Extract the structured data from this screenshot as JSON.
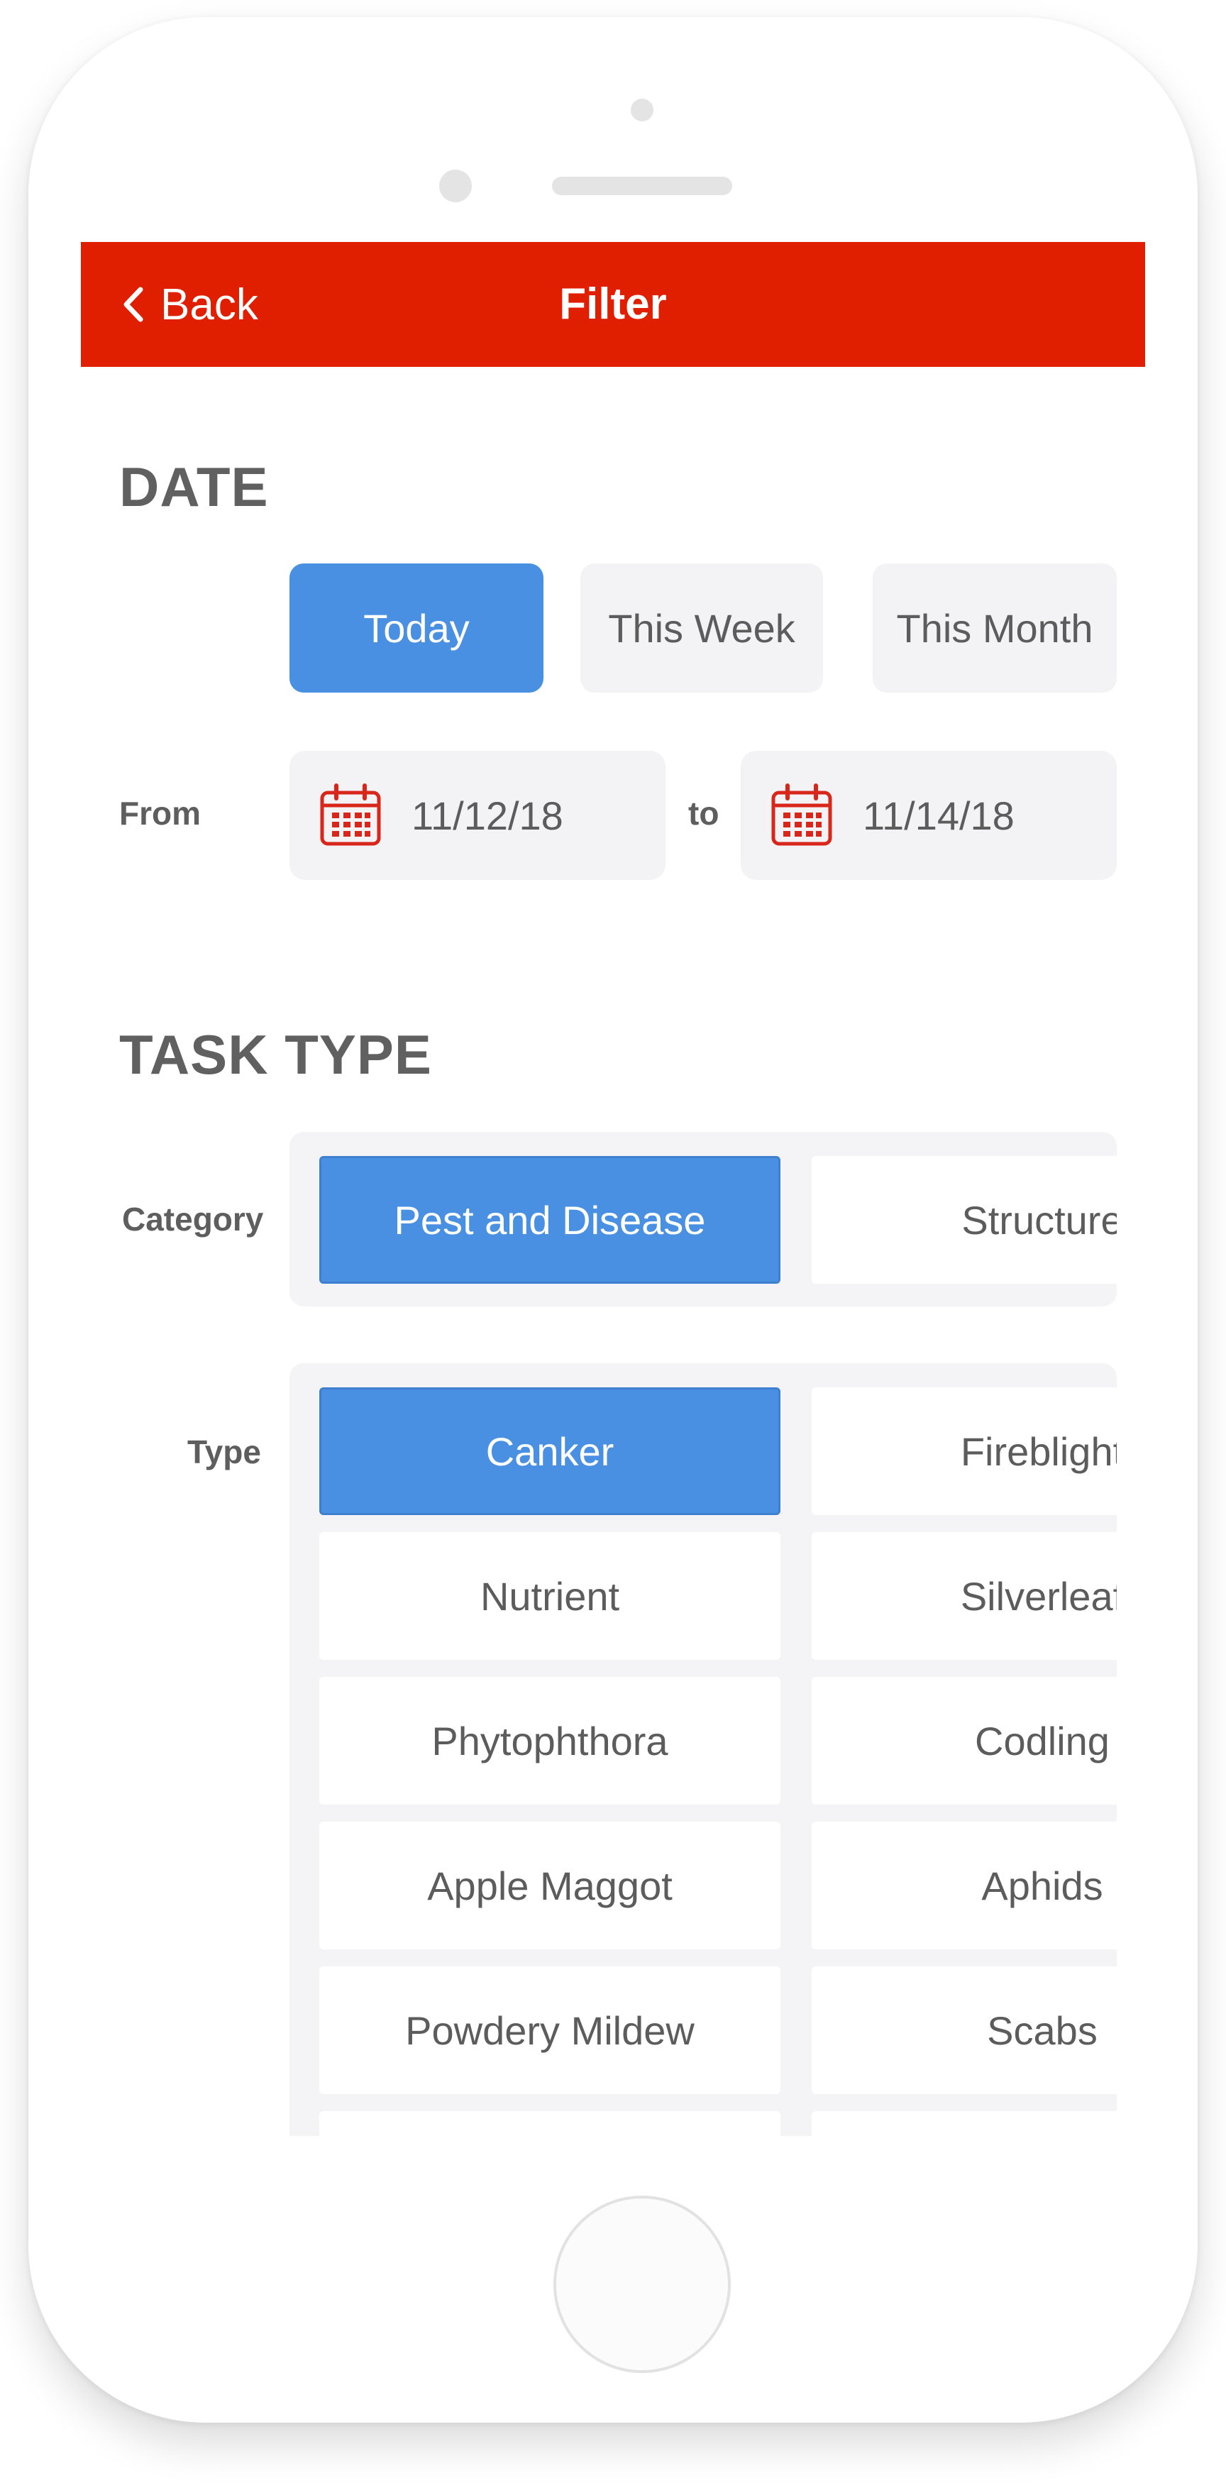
{
  "header": {
    "back_label": "Back",
    "title": "Filter"
  },
  "date_section": {
    "title": "DATE",
    "presets": [
      "Today",
      "This Week",
      "This Month"
    ],
    "selected_preset": "Today",
    "from_label": "From",
    "to_label": "to",
    "from_value": "11/12/18",
    "to_value": "11/14/18",
    "icons": {
      "date_field": "calendar-icon"
    }
  },
  "task_type_section": {
    "title": "TASK TYPE",
    "category_label": "Category",
    "categories": [
      "Pest and Disease",
      "Structure"
    ],
    "selected_category": "Pest and Disease",
    "type_label": "Type",
    "types": [
      [
        "Canker",
        "Fireblight"
      ],
      [
        "Nutrient",
        "Silverleaf"
      ],
      [
        "Phytophthora",
        "Codling"
      ],
      [
        "Apple Maggot",
        "Aphids"
      ],
      [
        "Powdery Mildew",
        "Scabs"
      ]
    ],
    "selected_type": "Canker"
  },
  "colors": {
    "header_bg": "#e01e00",
    "accent": "#4a90e2",
    "chip_bg": "#f3f3f5",
    "text": "#5c5c5c",
    "icon": "#d8261a"
  }
}
